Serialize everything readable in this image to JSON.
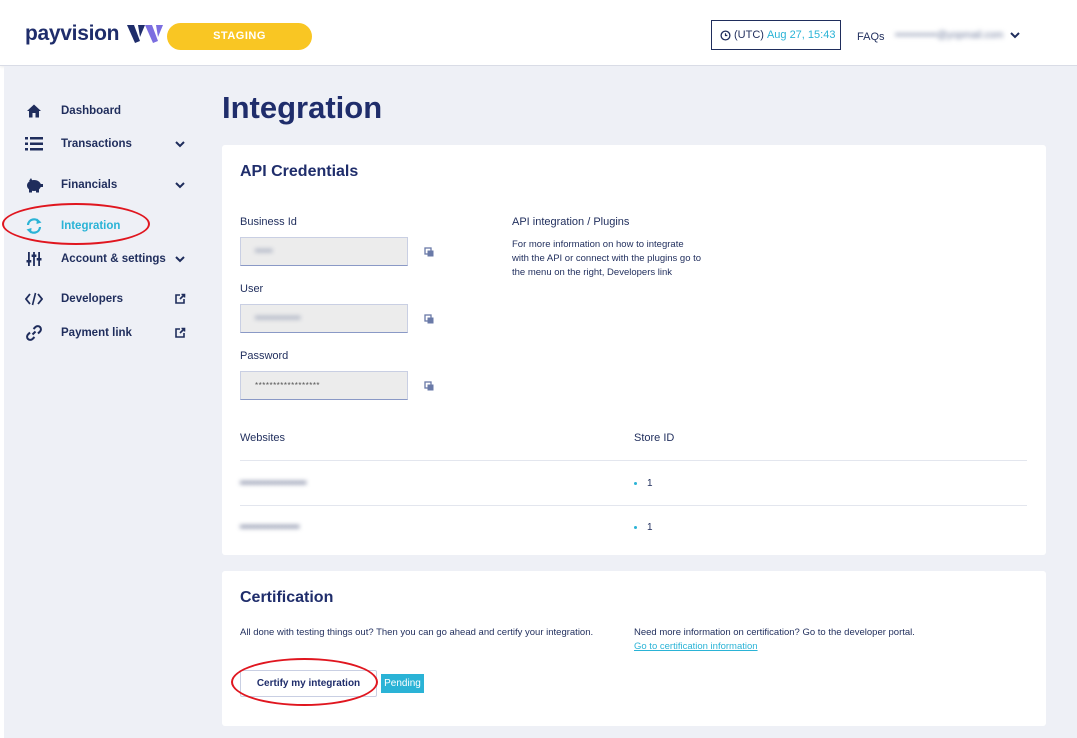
{
  "header": {
    "logo_text": "payvision",
    "environment_badge": "STAGING",
    "timezone": "(UTC)",
    "datetime": "Aug 27, 15:43",
    "faqs_label": "FAQs",
    "user_email": "••••••••••••@yopmail.com"
  },
  "sidebar": {
    "items": [
      {
        "label": "Dashboard",
        "icon": "home-icon"
      },
      {
        "label": "Transactions",
        "icon": "list-icon",
        "trailing": "chevron-down-icon"
      },
      {
        "label": "Financials",
        "icon": "piggy-bank-icon",
        "trailing": "chevron-down-icon"
      },
      {
        "label": "Integration",
        "icon": "sync-icon",
        "active": true
      },
      {
        "label": "Account & settings",
        "icon": "sliders-icon",
        "trailing": "chevron-down-icon"
      },
      {
        "label": "Developers",
        "icon": "code-icon",
        "trailing": "external-link-icon"
      },
      {
        "label": "Payment link",
        "icon": "link-icon",
        "trailing": "external-link-icon"
      }
    ]
  },
  "main": {
    "title": "Integration",
    "api_credentials": {
      "title": "API Credentials",
      "fields": [
        {
          "label": "Business Id",
          "value": "•••••"
        },
        {
          "label": "User",
          "value": "•••••••••••••"
        },
        {
          "label": "Password",
          "value": "******************"
        }
      ],
      "info_title": "API integration / Plugins",
      "info_text": "For more information on how to integrate with the API or connect with the plugins go to the menu on the right, Developers link",
      "table": {
        "columns": [
          "Websites",
          "Store ID"
        ],
        "rows": [
          {
            "website": "•••••••••••••••••••",
            "store_id": "1"
          },
          {
            "website": "•••••••••••••••••",
            "store_id": "1"
          }
        ]
      }
    },
    "certification": {
      "title": "Certification",
      "description": "All done with testing things out? Then you can go ahead and certify your integration.",
      "info_text": "Need more information on certification? Go to the developer portal.",
      "info_link": "Go to certification information",
      "button_label": "Certify my integration",
      "status": "Pending"
    }
  },
  "colors": {
    "primary": "#1f2d6b",
    "accent": "#2ab3d6",
    "badge": "#f9c623",
    "highlight": "#e0161f"
  }
}
